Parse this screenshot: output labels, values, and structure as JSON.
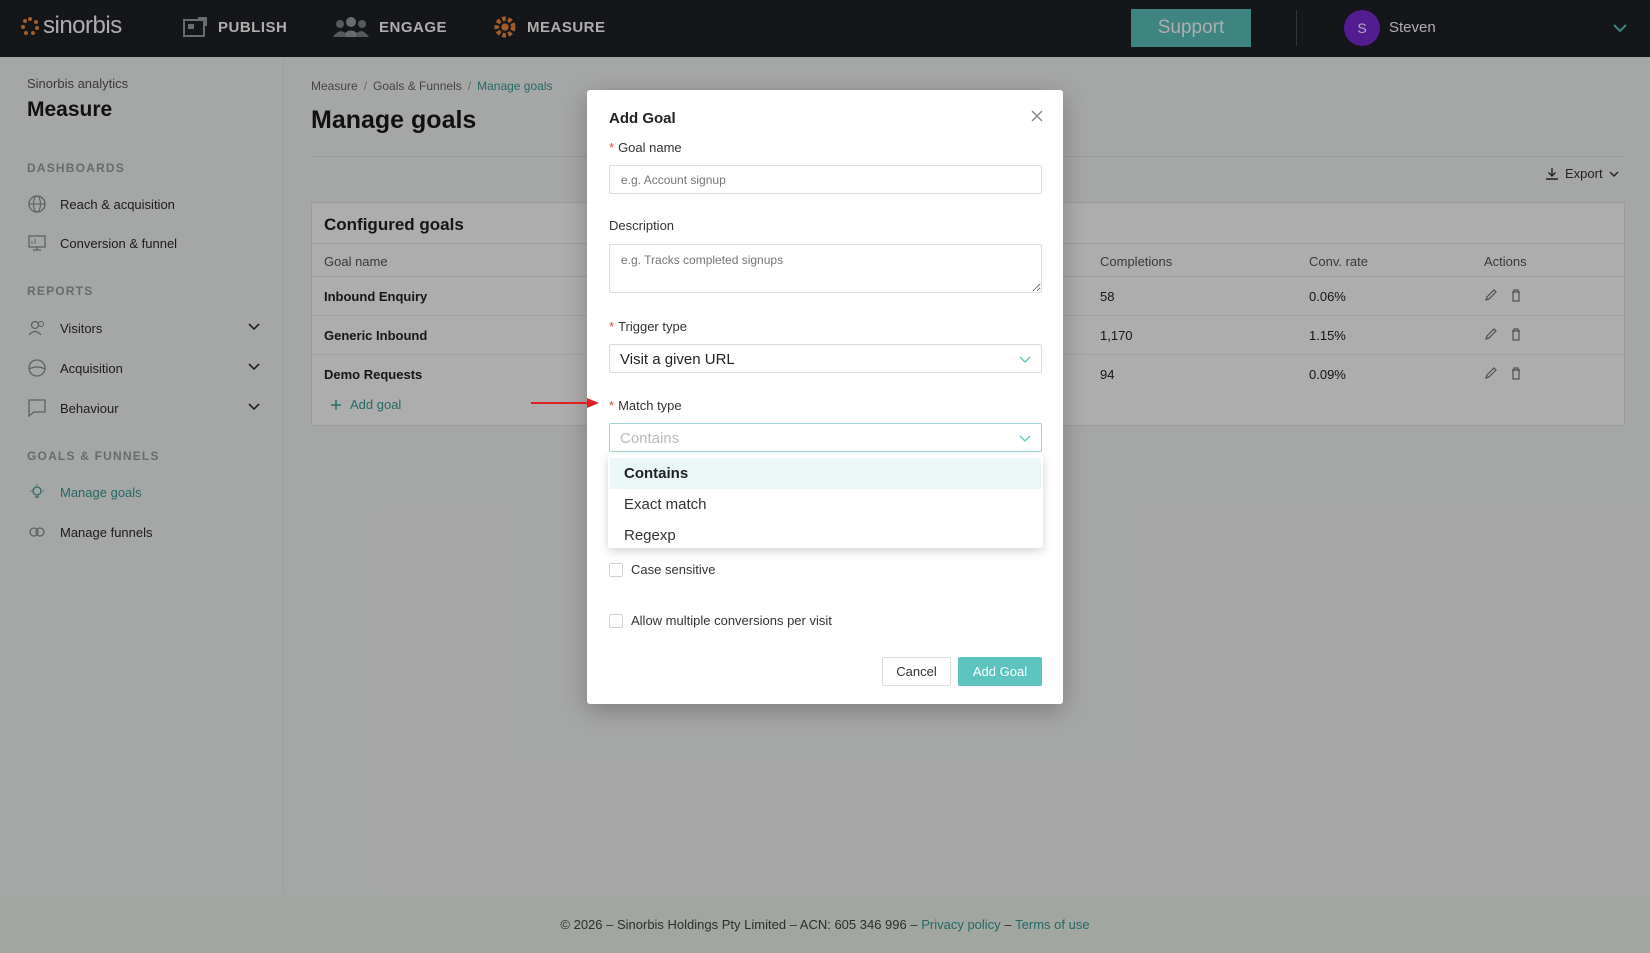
{
  "brand": {
    "name": "sinorbis",
    "accent": "#5cc3bf",
    "logo_dot_color": "#f08a3c"
  },
  "topnav": {
    "items": [
      {
        "label": "PUBLISH",
        "icon": "publish-icon"
      },
      {
        "label": "ENGAGE",
        "icon": "engage-icon"
      },
      {
        "label": "MEASURE",
        "icon": "gear-icon"
      }
    ],
    "support_label": "Support",
    "user": {
      "initial": "S",
      "name": "Steven",
      "avatar_color": "#7b2bd6"
    }
  },
  "sidebar": {
    "subtitle": "Sinorbis analytics",
    "title": "Measure",
    "sections": [
      {
        "label": "DASHBOARDS",
        "items": [
          {
            "label": "Reach & acquisition",
            "icon": "globe-icon"
          },
          {
            "label": "Conversion & funnel",
            "icon": "monitor-icon"
          }
        ]
      },
      {
        "label": "REPORTS",
        "items": [
          {
            "label": "Visitors",
            "icon": "visitors-icon"
          },
          {
            "label": "Acquisition",
            "icon": "acquisition-icon"
          },
          {
            "label": "Behaviour",
            "icon": "chat-icon"
          }
        ]
      },
      {
        "label": "GOALS & FUNNELS",
        "items": [
          {
            "label": "Manage goals",
            "icon": "bulb-icon"
          },
          {
            "label": "Manage funnels",
            "icon": "funnel-icon"
          }
        ]
      }
    ]
  },
  "breadcrumb": [
    "Measure",
    "Goals & Funnels",
    "Manage goals"
  ],
  "page_title": "Manage goals",
  "export_label": "Export",
  "goals_table": {
    "title": "Configured goals",
    "columns": [
      "Goal name",
      "Completions",
      "Conv. rate",
      "Actions"
    ],
    "rows": [
      {
        "name": "Inbound Enquiry",
        "completions": "58",
        "rate": "0.06%"
      },
      {
        "name": "Generic Inbound",
        "completions": "1,170",
        "rate": "1.15%"
      },
      {
        "name": "Demo Requests",
        "completions": "94",
        "rate": "0.09%"
      }
    ],
    "add_label": "Add goal"
  },
  "footer": {
    "text": "© 2026 – Sinorbis Holdings Pty Limited – ACN: 605 346 996 – ",
    "privacy": "Privacy policy",
    "dash": " – ",
    "terms": "Terms of use"
  },
  "modal": {
    "title": "Add Goal",
    "goal_name_label": "Goal name",
    "goal_name_placeholder": "e.g. Account signup",
    "description_label": "Description",
    "description_placeholder": "e.g. Tracks completed signups",
    "trigger_label": "Trigger type",
    "trigger_value": "Visit a given URL",
    "match_label": "Match type",
    "match_value": "Contains",
    "match_options": [
      "Contains",
      "Exact match",
      "Regexp"
    ],
    "case_sensitive_label": "Case sensitive",
    "multiple_label": "Allow multiple conversions per visit",
    "cancel_label": "Cancel",
    "add_label": "Add Goal"
  }
}
